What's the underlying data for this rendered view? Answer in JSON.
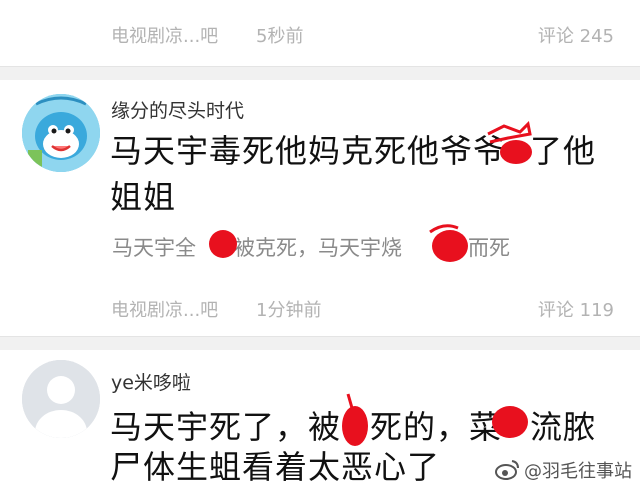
{
  "top_item": {
    "source": "电视剧凉...吧",
    "time": "5秒前",
    "comments": "评论 245"
  },
  "post1": {
    "username": "缘分的尽头时代",
    "line1": "马天宇毒死他妈克死他爷爷",
    "line1_tail": "了他",
    "line2": "姐姐",
    "quote_a": "马天宇全",
    "quote_b": "被克死，马天宇烧",
    "quote_c": "而死",
    "source": "电视剧凉...吧",
    "time": "1分钟前",
    "comments": "评论 119",
    "avatar_icon": "cartoon-character-avatar"
  },
  "post2": {
    "username": "ye米哆啦",
    "line1_a": "马天宇死了，被",
    "line1_b": "死的，菜",
    "line1_c": "流脓",
    "line2": "尸体生蛆看着太恶心了",
    "avatar_icon": "default-user-avatar"
  },
  "watermark": {
    "text": "@羽毛往事站",
    "icon": "weibo-logo-icon"
  },
  "colors": {
    "scribble": "#e8101e",
    "meta_text": "#b3b3b3",
    "separator": "#f1f1f1"
  }
}
